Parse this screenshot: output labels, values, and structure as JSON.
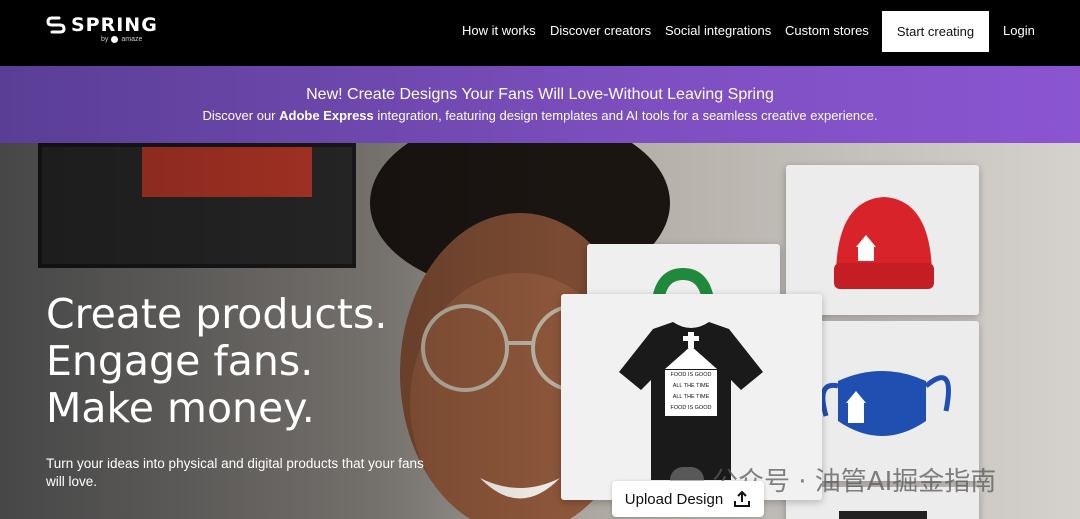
{
  "nav": {
    "logo_text": "SPRING",
    "logo_by": "by",
    "logo_brand": "amaze",
    "links": [
      "How it works",
      "Discover creators",
      "Social integrations",
      "Custom stores"
    ],
    "start_button": "Start creating",
    "login": "Login"
  },
  "banner": {
    "title": "New! Create Designs Your Fans Will Love-Without Leaving Spring",
    "sub_prefix": "Discover our ",
    "sub_bold": "Adobe Express",
    "sub_suffix": " integration, featuring design templates and AI tools for a seamless creative experience."
  },
  "hero": {
    "headline": [
      "Create products.",
      "Engage fans.",
      "Make money."
    ],
    "description": "Turn your ideas into physical and digital products that your fans will love.",
    "upload_button": "Upload Design",
    "shirt_print": [
      "FOOD IS GOOD",
      "ALL THE TIME",
      "ALL THE TIME",
      "FOOD IS GOOD"
    ]
  },
  "watermark": "公众号 · 油管AI掘金指南",
  "colors": {
    "banner_start": "#5a3e95",
    "banner_end": "#8b55d2",
    "beanie": "#d8232a",
    "mask": "#1f4fb0",
    "backpack": "#1f8a3c"
  },
  "icons": [
    "spring-logo-icon",
    "upload-icon",
    "wechat-icon"
  ]
}
